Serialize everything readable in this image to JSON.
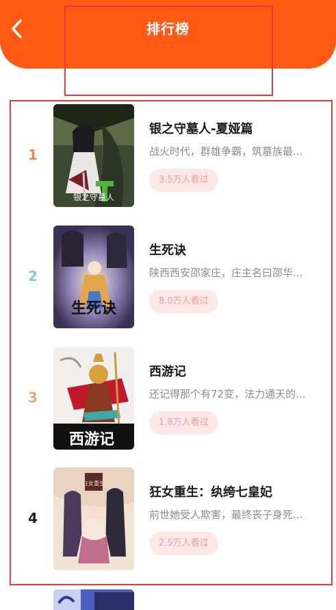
{
  "header": {
    "title": "排行榜",
    "back_icon": "chevron-left-icon",
    "background_color": "#ff5a14"
  },
  "list": [
    {
      "rank": "1",
      "rank_color": "#f0894a",
      "title": "银之守墓人-夏娅篇",
      "description": "战火时代，群雄争霸，筑墓族最...",
      "views": "3.5万人看过",
      "cover_text": "银之守墓人",
      "cover_palette": [
        "#3d4a32",
        "#1e2519",
        "#7a1e26",
        "#4fb33e"
      ]
    },
    {
      "rank": "2",
      "rank_color": "#8ec3d8",
      "title": "生死诀",
      "description": "陕西西安邵家庄，庄主名曰邵华...",
      "views": "8.0万人看过",
      "cover_text": "生死诀",
      "cover_palette": [
        "#6f6a9a",
        "#3a3255",
        "#e3a64a",
        "#111111"
      ]
    },
    {
      "rank": "3",
      "rank_color": "#e8a87c",
      "title": "西游记",
      "description": "还记得那个有72变，法力通天的...",
      "views": "1.8万人看过",
      "cover_text": "西游记",
      "cover_palette": [
        "#f1eeee",
        "#c3192a",
        "#d8a23a",
        "#111111"
      ]
    },
    {
      "rank": "4",
      "rank_color": "#222222",
      "title": "狂女重生：纨绔七皇妃",
      "description": "前世她受人欺害，最终丧子身死...",
      "views": "2.5万人看过",
      "cover_text": "狂女重生",
      "cover_palette": [
        "#f2e2d2",
        "#4b3a5e",
        "#c26d8c",
        "#2f2a3a"
      ]
    }
  ]
}
